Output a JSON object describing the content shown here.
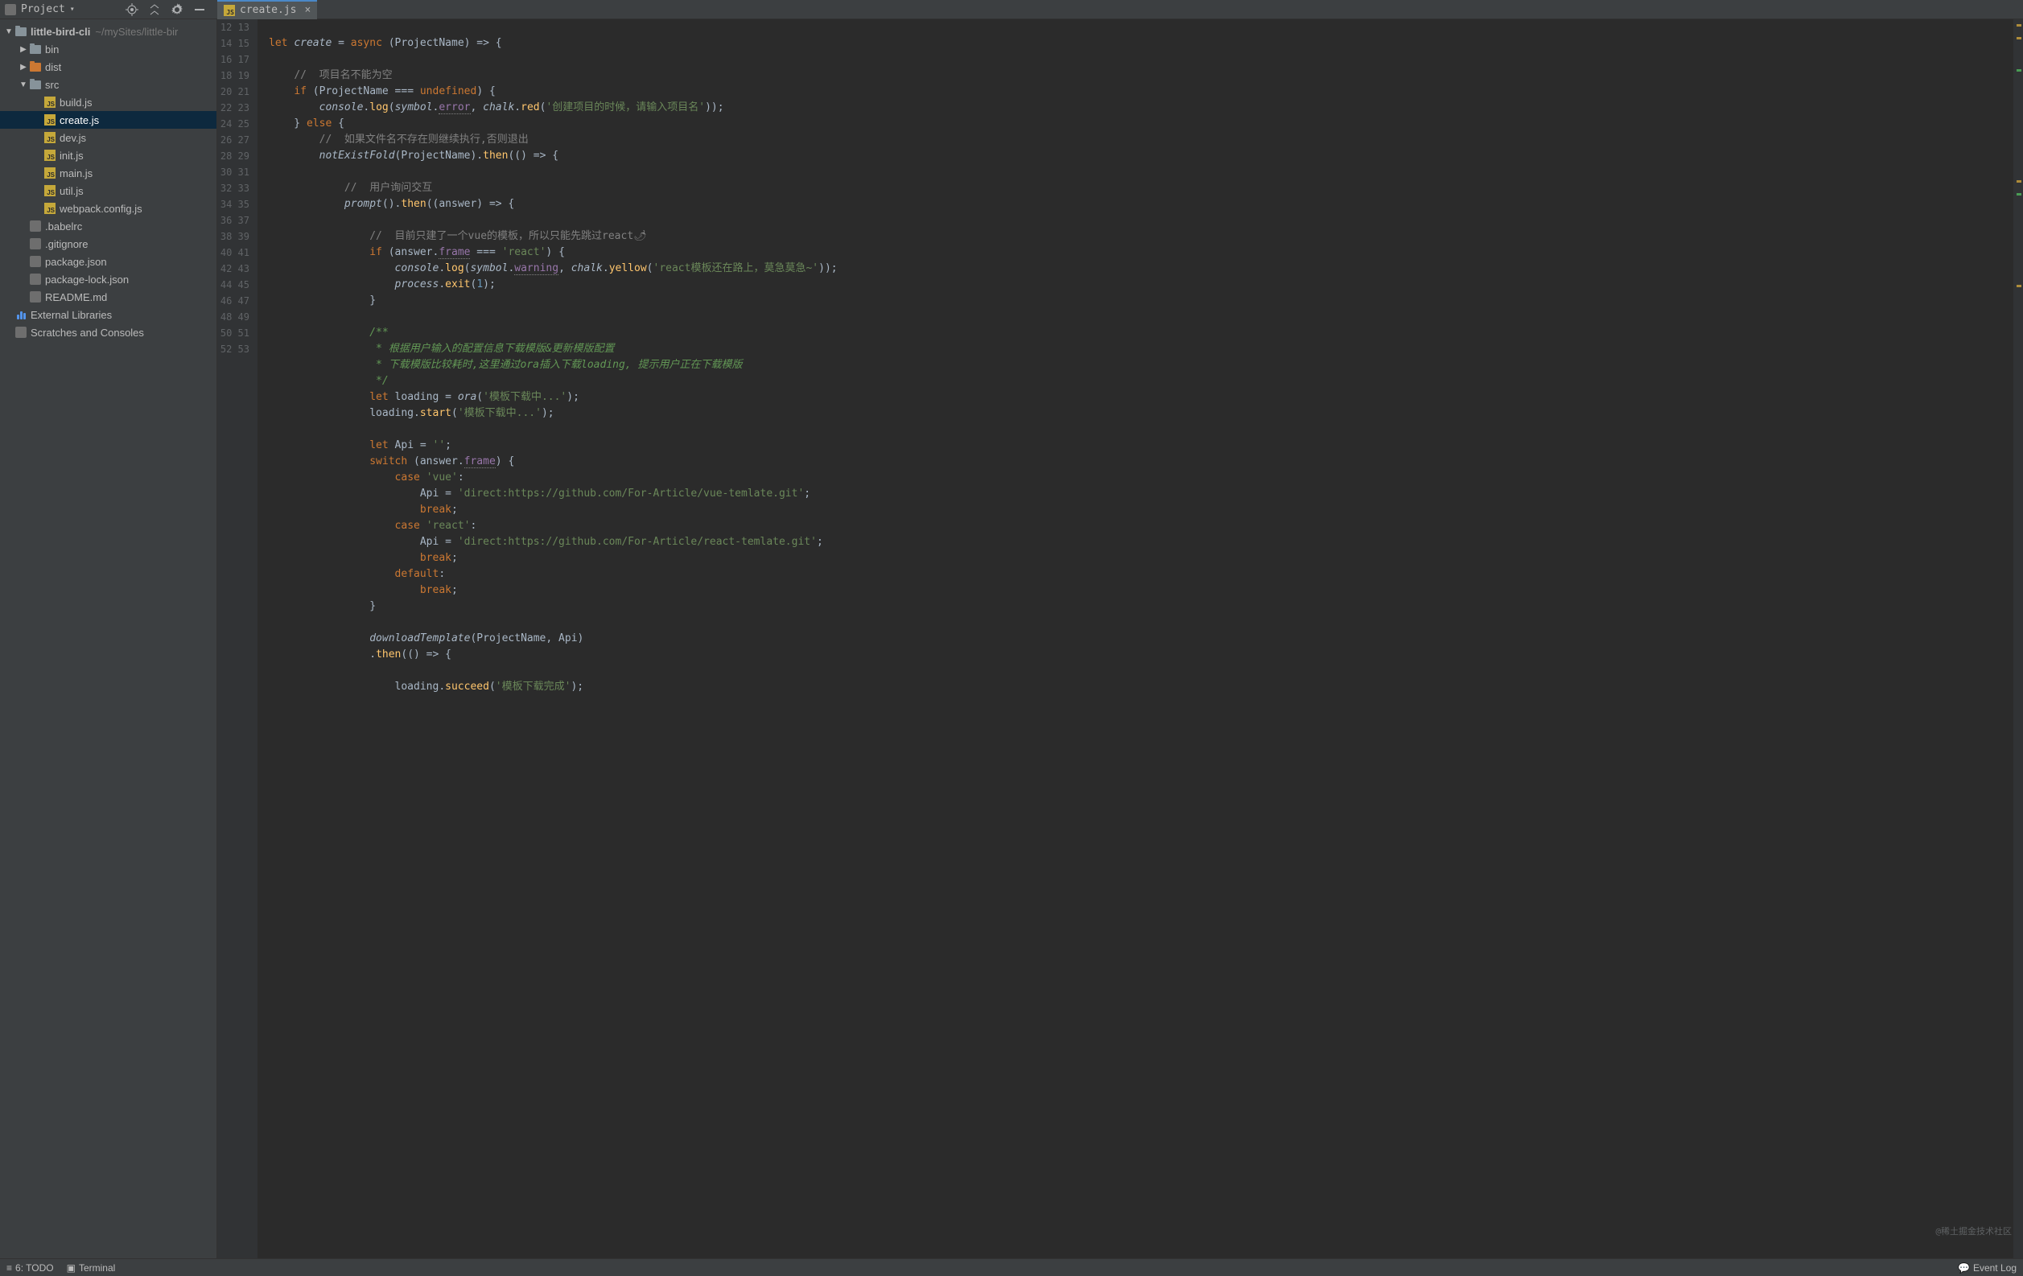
{
  "toolbar": {
    "project_label": "Project",
    "icons": [
      "target-icon",
      "collapse-icon",
      "gear-icon",
      "hide-icon"
    ]
  },
  "tab": {
    "filename": "create.js"
  },
  "tree": {
    "root": {
      "name": "little-bird-cli",
      "path": "~/mySites/little-bir"
    },
    "items": [
      {
        "depth": 1,
        "type": "folder",
        "name": "bin",
        "expanded": false
      },
      {
        "depth": 1,
        "type": "folder-orange",
        "name": "dist",
        "expanded": false
      },
      {
        "depth": 1,
        "type": "folder",
        "name": "src",
        "expanded": true
      },
      {
        "depth": 2,
        "type": "js",
        "name": "build.js"
      },
      {
        "depth": 2,
        "type": "js",
        "name": "create.js",
        "selected": true
      },
      {
        "depth": 2,
        "type": "js",
        "name": "dev.js"
      },
      {
        "depth": 2,
        "type": "js",
        "name": "init.js"
      },
      {
        "depth": 2,
        "type": "js",
        "name": "main.js"
      },
      {
        "depth": 2,
        "type": "js",
        "name": "util.js"
      },
      {
        "depth": 2,
        "type": "js",
        "name": "webpack.config.js"
      },
      {
        "depth": 1,
        "type": "cfg",
        "name": ".babelrc"
      },
      {
        "depth": 1,
        "type": "cfg",
        "name": ".gitignore"
      },
      {
        "depth": 1,
        "type": "cfg",
        "name": "package.json"
      },
      {
        "depth": 1,
        "type": "cfg",
        "name": "package-lock.json"
      },
      {
        "depth": 1,
        "type": "cfg",
        "name": "README.md"
      },
      {
        "depth": 0,
        "type": "lib",
        "name": "External Libraries"
      },
      {
        "depth": 0,
        "type": "cfg",
        "name": "Scratches and Consoles"
      }
    ]
  },
  "editor": {
    "first_line": 12,
    "lines": [
      "",
      "let create = async (ProjectName) => {",
      "",
      "    //  项目名不能为空",
      "    if (ProjectName === undefined) {",
      "        console.log(symbol.error, chalk.red('创建项目的时候，请输入项目名'));",
      "    } else {",
      "        //  如果文件名不存在则继续执行,否则退出",
      "        notExistFold(ProjectName).then(() => {",
      "",
      "            //  用户询问交互",
      "            prompt().then((answer) => {",
      "",
      "                //  目前只建了一个vue的模板，所以只能先跳过react🌶",
      "                if (answer.frame === 'react') {",
      "                    console.log(symbol.warning, chalk.yellow('react模板还在路上，莫急莫急~'));",
      "                    process.exit(1);",
      "                }",
      "",
      "                /**",
      "                 * 根据用户输入的配置信息下载模版&更新模版配置",
      "                 * 下载模版比较耗时,这里通过ora插入下载loading, 提示用户正在下载模版",
      "                 */",
      "                let loading = ora('模板下载中...');",
      "                loading.start('模板下载中...');",
      "",
      "                let Api = '';",
      "                switch (answer.frame) {",
      "                    case 'vue':",
      "                        Api = 'direct:https://github.com/For-Article/vue-temlate.git';",
      "                        break;",
      "                    case 'react':",
      "                        Api = 'direct:https://github.com/For-Article/react-temlate.git';",
      "                        break;",
      "                    default:",
      "                        break;",
      "                }",
      "",
      "                downloadTemplate(ProjectName, Api)",
      "                .then(() => {",
      "",
      "                    loading.succeed('模板下载完成');"
    ]
  },
  "statusbar": {
    "todo": "6: TODO",
    "terminal": "Terminal",
    "event_log": "Event Log"
  },
  "watermark": "@稀土掘金技术社区"
}
